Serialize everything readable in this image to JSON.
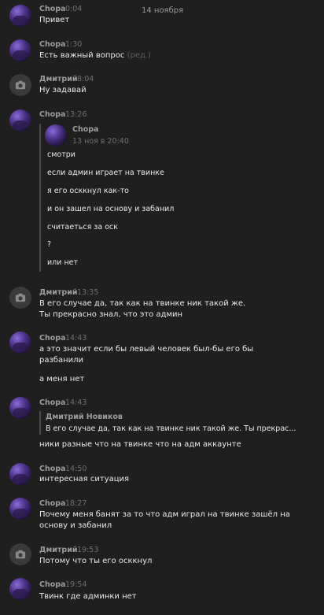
{
  "date_header": "14 ноября",
  "messages": [
    {
      "author": "Chopa",
      "time": "0:04",
      "lines": [
        "Привет"
      ]
    },
    {
      "author": "Chopa",
      "time": "1:30",
      "lines": [
        "Есть важный вопрос"
      ],
      "edited": "(ред.)"
    },
    {
      "author": "Дмитрий",
      "time": "8:04",
      "lines": [
        "Ну задавай"
      ]
    },
    {
      "author": "Chopa",
      "time": "13:26",
      "forward": {
        "author": "Chopa",
        "time": "13 ноя в 20:40",
        "lines": [
          "смотри",
          "если админ играет на твинке",
          "я его осккнул как-то",
          "и он зашел на основу и забанил",
          "считаеться за оск",
          "?",
          "или нет"
        ]
      }
    },
    {
      "author": "Дмитрий",
      "time": "13:35",
      "lines": [
        "В его случае да, так как на твинке ник такой же.",
        "Ты прекрасно знал, что это админ"
      ]
    },
    {
      "author": "Chopa",
      "time": "14:43",
      "lines": [
        "а это значит если бы левый человек был-бы его бы",
        "разбанили",
        "а меня нет"
      ]
    },
    {
      "author": "Chopa",
      "time": "14:43",
      "reply": {
        "author": "Дмитрий Новиков",
        "text": "В его случае да, так как на твинке ник такой же. Ты прекрас..."
      },
      "lines": [
        "ники разные что на твинке что на адм аккаунте"
      ]
    },
    {
      "author": "Chopa",
      "time": "14:50",
      "lines": [
        "интересная ситуация"
      ]
    },
    {
      "author": "Chopa",
      "time": "18:27",
      "lines": [
        "Почему меня банят за то что адм играл на твинке зашёл на",
        "основу и забанил"
      ]
    },
    {
      "author": "Дмитрий",
      "time": "19:53",
      "lines": [
        "Потому что ты его осккнул"
      ]
    },
    {
      "author": "Chopa",
      "time": "19:54",
      "lines": [
        "Твинк где админки нет"
      ]
    }
  ]
}
